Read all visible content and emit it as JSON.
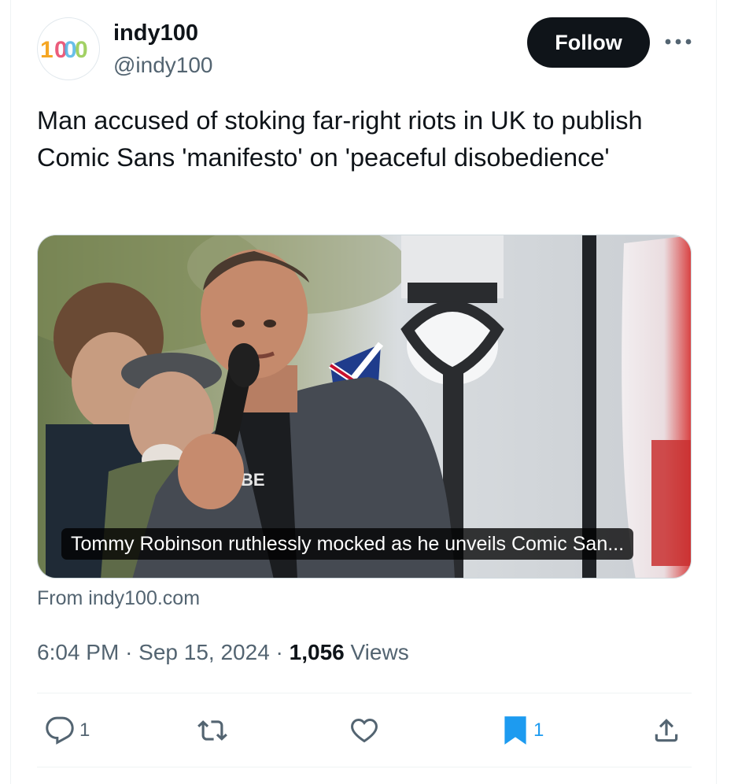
{
  "author": {
    "display_name": "indy100",
    "handle": "@indy100",
    "avatar_text": "100"
  },
  "follow_label": "Follow",
  "tweet_text": "Man accused of stoking far-right riots in UK to publish Comic Sans 'manifesto' on 'peaceful disobedience'",
  "card": {
    "caption": "Tommy Robinson ruthlessly mocked as he unveils Comic San...",
    "source": "From indy100.com"
  },
  "meta": {
    "time": "6:04 PM",
    "separator": "·",
    "date": "Sep 15, 2024",
    "views_count": "1,056",
    "views_label": "Views"
  },
  "actions": {
    "reply_count": "1",
    "bookmark_count": "1"
  },
  "colors": {
    "accent_blue": "#1d9bf0",
    "follow_bg": "#0f1419",
    "secondary_text": "#536471"
  },
  "icons": [
    "more-icon",
    "reply-icon",
    "retweet-icon",
    "like-icon",
    "bookmark-icon",
    "share-icon"
  ]
}
